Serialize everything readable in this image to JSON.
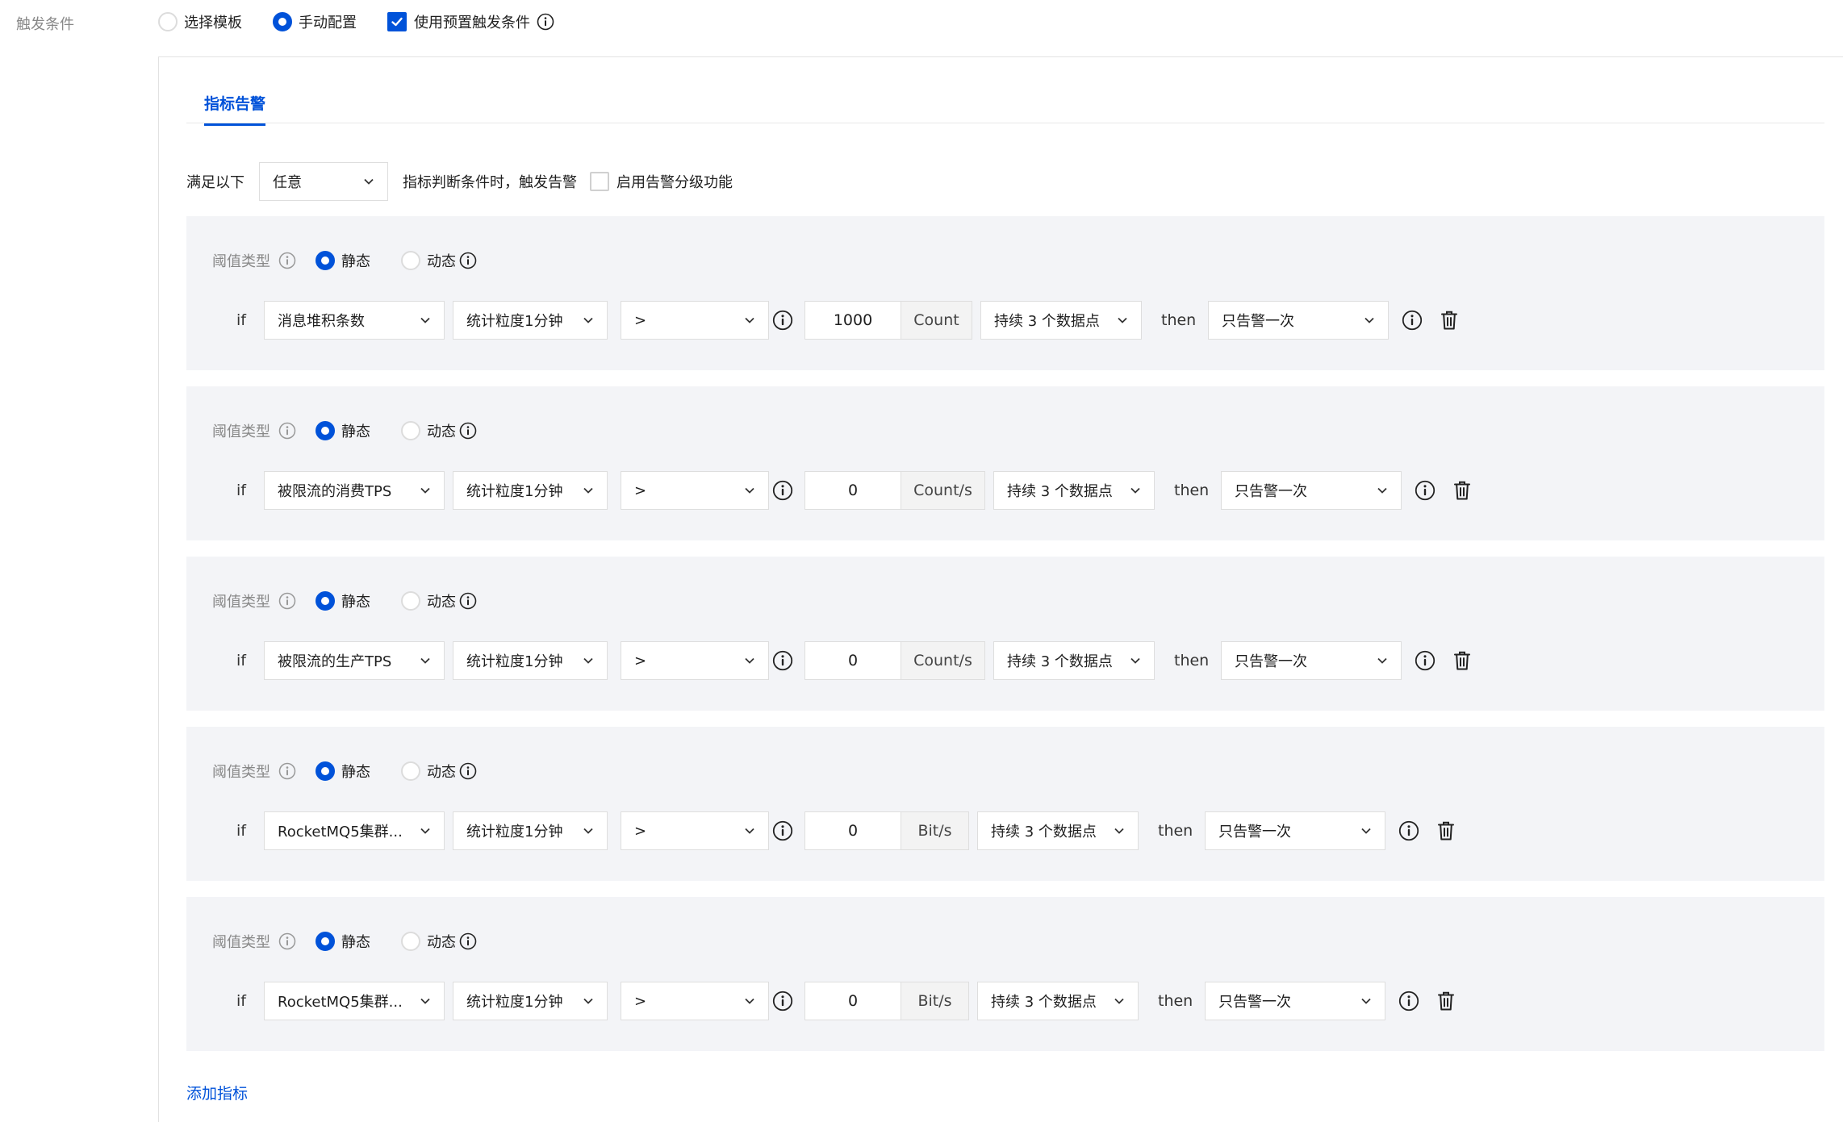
{
  "trigger": {
    "label": "触发条件",
    "options": [
      {
        "label": "选择模板",
        "selected": false
      },
      {
        "label": "手动配置",
        "selected": true
      }
    ],
    "use_preset": {
      "label": "使用预置触发条件",
      "checked": true
    }
  },
  "tabs": [
    {
      "label": "指标告警",
      "active": true
    }
  ],
  "match": {
    "prefix": "满足以下",
    "mode": "任意",
    "suffix": "指标判断条件时，触发告警",
    "grading": {
      "label": "启用告警分级功能",
      "checked": false
    }
  },
  "threshold_label": "阈值类型",
  "static_label": "静态",
  "dynamic_label": "动态",
  "if_label": "if",
  "then_label": "then",
  "conditions": [
    {
      "metric": "消息堆积条数",
      "period": "统计粒度1分钟",
      "operator": ">",
      "value": "1000",
      "unit": "Count",
      "duration": "持续 3 个数据点",
      "frequency": "只告警一次",
      "threshold_type": "static"
    },
    {
      "metric": "被限流的消费TPS",
      "period": "统计粒度1分钟",
      "operator": ">",
      "value": "0",
      "unit": "Count/s",
      "duration": "持续 3 个数据点",
      "frequency": "只告警一次",
      "threshold_type": "static"
    },
    {
      "metric": "被限流的生产TPS",
      "period": "统计粒度1分钟",
      "operator": ">",
      "value": "0",
      "unit": "Count/s",
      "duration": "持续 3 个数据点",
      "frequency": "只告警一次",
      "threshold_type": "static"
    },
    {
      "metric": "RocketMQ5集群...",
      "period": "统计粒度1分钟",
      "operator": ">",
      "value": "0",
      "unit": "Bit/s",
      "duration": "持续 3 个数据点",
      "frequency": "只告警一次",
      "threshold_type": "static"
    },
    {
      "metric": "RocketMQ5集群...",
      "period": "统计粒度1分钟",
      "operator": ">",
      "value": "0",
      "unit": "Bit/s",
      "duration": "持续 3 个数据点",
      "frequency": "只告警一次",
      "threshold_type": "static"
    }
  ],
  "add_metric_label": "添加指标",
  "colors": {
    "accent": "#0052d9",
    "block_bg": "#f3f4f7",
    "border": "#dedede",
    "muted_text": "#888888"
  }
}
